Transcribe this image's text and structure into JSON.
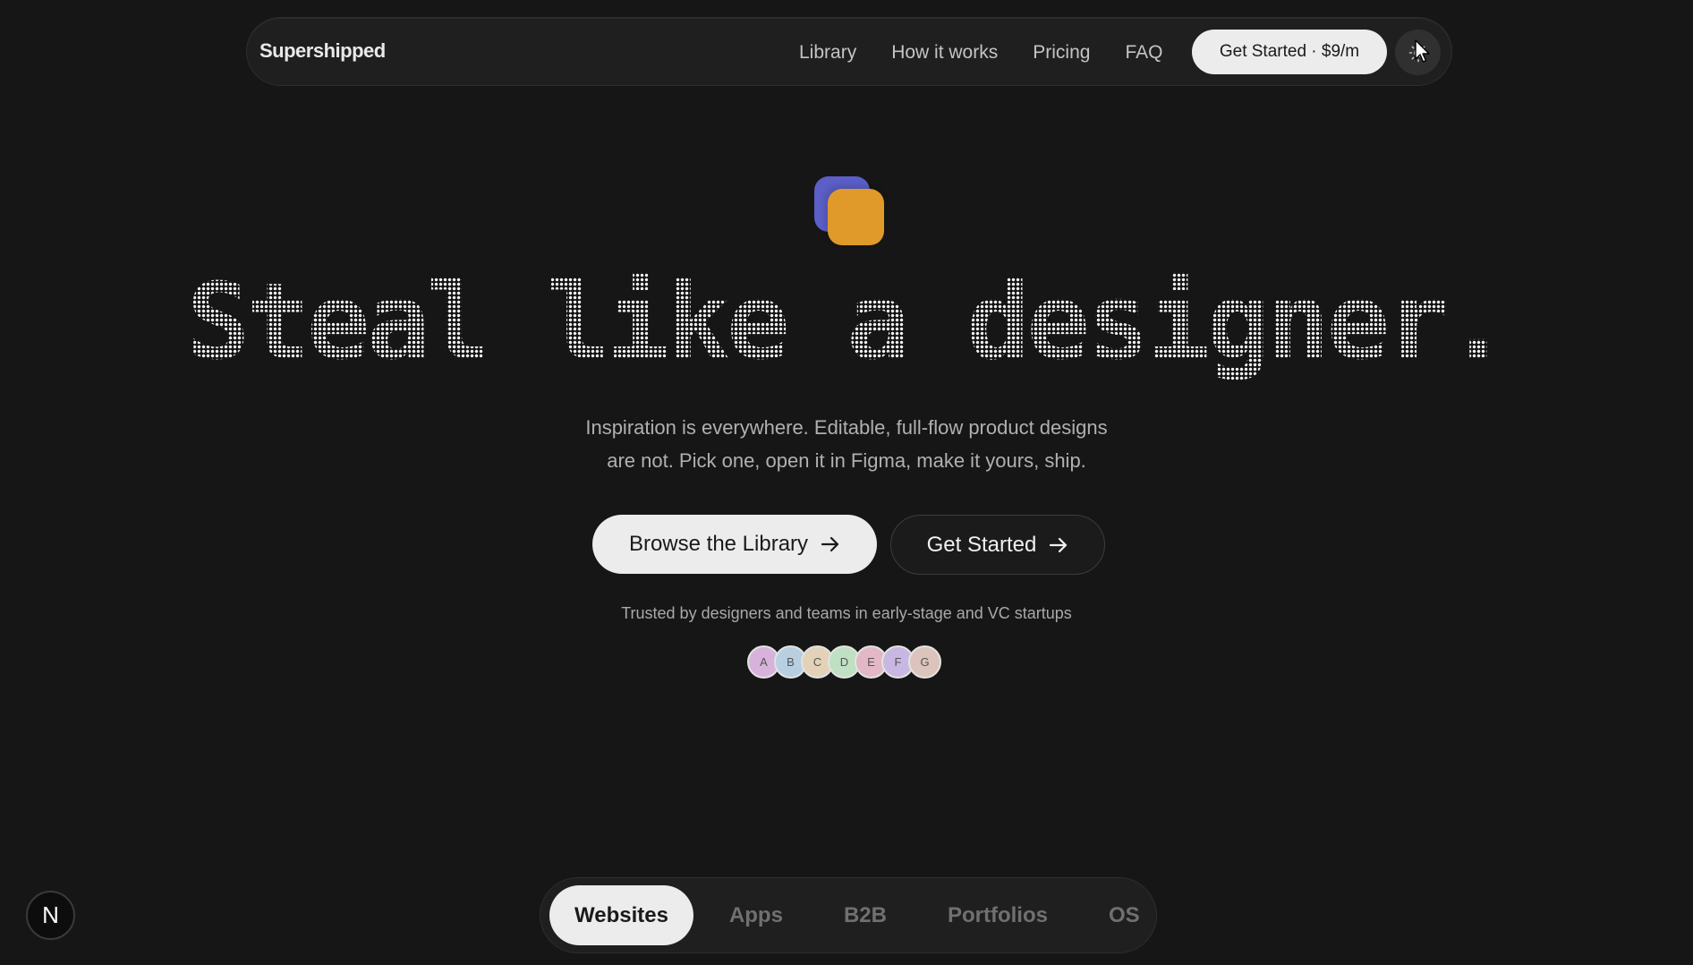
{
  "nav": {
    "brand": "Supershipped",
    "links": [
      "Library",
      "How it works",
      "Pricing",
      "FAQ"
    ],
    "cta_label": "Get Started · $9/m",
    "theme_toggle_icon": "sun-icon"
  },
  "hero": {
    "logo_colors": {
      "back": "#5b5fc7",
      "front": "#df9a2a"
    },
    "headline": "Steal like a designer.",
    "subtitle_line1": "Inspiration is everywhere. Editable, full-flow product designs",
    "subtitle_line2": "are not. Pick one, open it in Figma, make it yours, ship.",
    "primary_button": "Browse the Library",
    "secondary_button": "Get Started",
    "trusted_text": "Trusted by designers and teams in early-stage and VC startups",
    "avatars": [
      {
        "letter": "A",
        "color": "#d7b3dc"
      },
      {
        "letter": "B",
        "color": "#b7cfe0"
      },
      {
        "letter": "C",
        "color": "#e3d2b8"
      },
      {
        "letter": "D",
        "color": "#bfe0c2"
      },
      {
        "letter": "E",
        "color": "#e3b7c6"
      },
      {
        "letter": "F",
        "color": "#c9b7e3"
      },
      {
        "letter": "G",
        "color": "#dcc4bc"
      }
    ]
  },
  "categories": {
    "tabs": [
      "Websites",
      "Apps",
      "B2B",
      "Portfolios",
      "OS"
    ],
    "active": "Websites"
  },
  "badge": {
    "label": "N"
  }
}
